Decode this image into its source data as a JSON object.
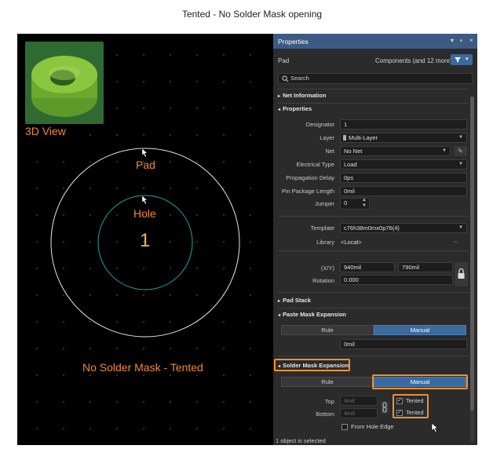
{
  "figure_title": "Tented - No Solder Mask opening",
  "pcb": {
    "label_3d": "3D View",
    "label_pad": "Pad",
    "label_hole": "Hole",
    "designator": "1",
    "caption": "No Solder Mask - Tented"
  },
  "panel": {
    "title": "Properties",
    "object_type": "Pad",
    "filter_text": "Components (and 12 more)",
    "search_placeholder": "Search",
    "sections": {
      "net_information": "Net Information",
      "properties": "Properties",
      "pad_stack": "Pad Stack",
      "paste_mask": "Paste Mask Expansion",
      "solder_mask": "Solder Mask Expansion"
    },
    "fields": {
      "designator_label": "Designator",
      "designator_value": "1",
      "layer_label": "Layer",
      "layer_value": "Multi-Layer",
      "net_label": "Net",
      "net_value": "No Net",
      "electrical_type_label": "Electrical Type",
      "electrical_type_value": "Load",
      "propagation_delay_label": "Propagation Delay",
      "propagation_delay_value": "0ps",
      "pin_package_length_label": "Pin Package Length",
      "pin_package_length_value": "0mil",
      "jumper_label": "Jumper",
      "jumper_value": "0",
      "template_label": "Template",
      "template_value": "c76h38m0mx0p76(4)",
      "library_label": "Library",
      "library_value": "<Local>",
      "xy_label": "(X/Y)",
      "x_value": "940mil",
      "y_value": "790mil",
      "rotation_label": "Rotation",
      "rotation_value": "0.000"
    },
    "paste_mask": {
      "rule_label": "Rule",
      "manual_label": "Manual",
      "value": "0mil"
    },
    "solder_mask": {
      "rule_label": "Rule",
      "manual_label": "Manual",
      "top_label": "Top",
      "top_value": "4mil",
      "bottom_label": "Bottom",
      "bottom_value": "4mil",
      "tented_top_label": "Tented",
      "tented_bottom_label": "Tented",
      "from_hole_edge_label": "From Hole Edge"
    },
    "status": "1 object is selected"
  },
  "colors": {
    "accent": "#f0902e",
    "panel_bg": "#2b2b2b",
    "header_bg": "#3c5a82",
    "selected_seg": "#3a6a9e",
    "pad_ring": "#e6e6e6",
    "hole_ring": "#1fa3a3",
    "label_orange": "#f0883a"
  }
}
